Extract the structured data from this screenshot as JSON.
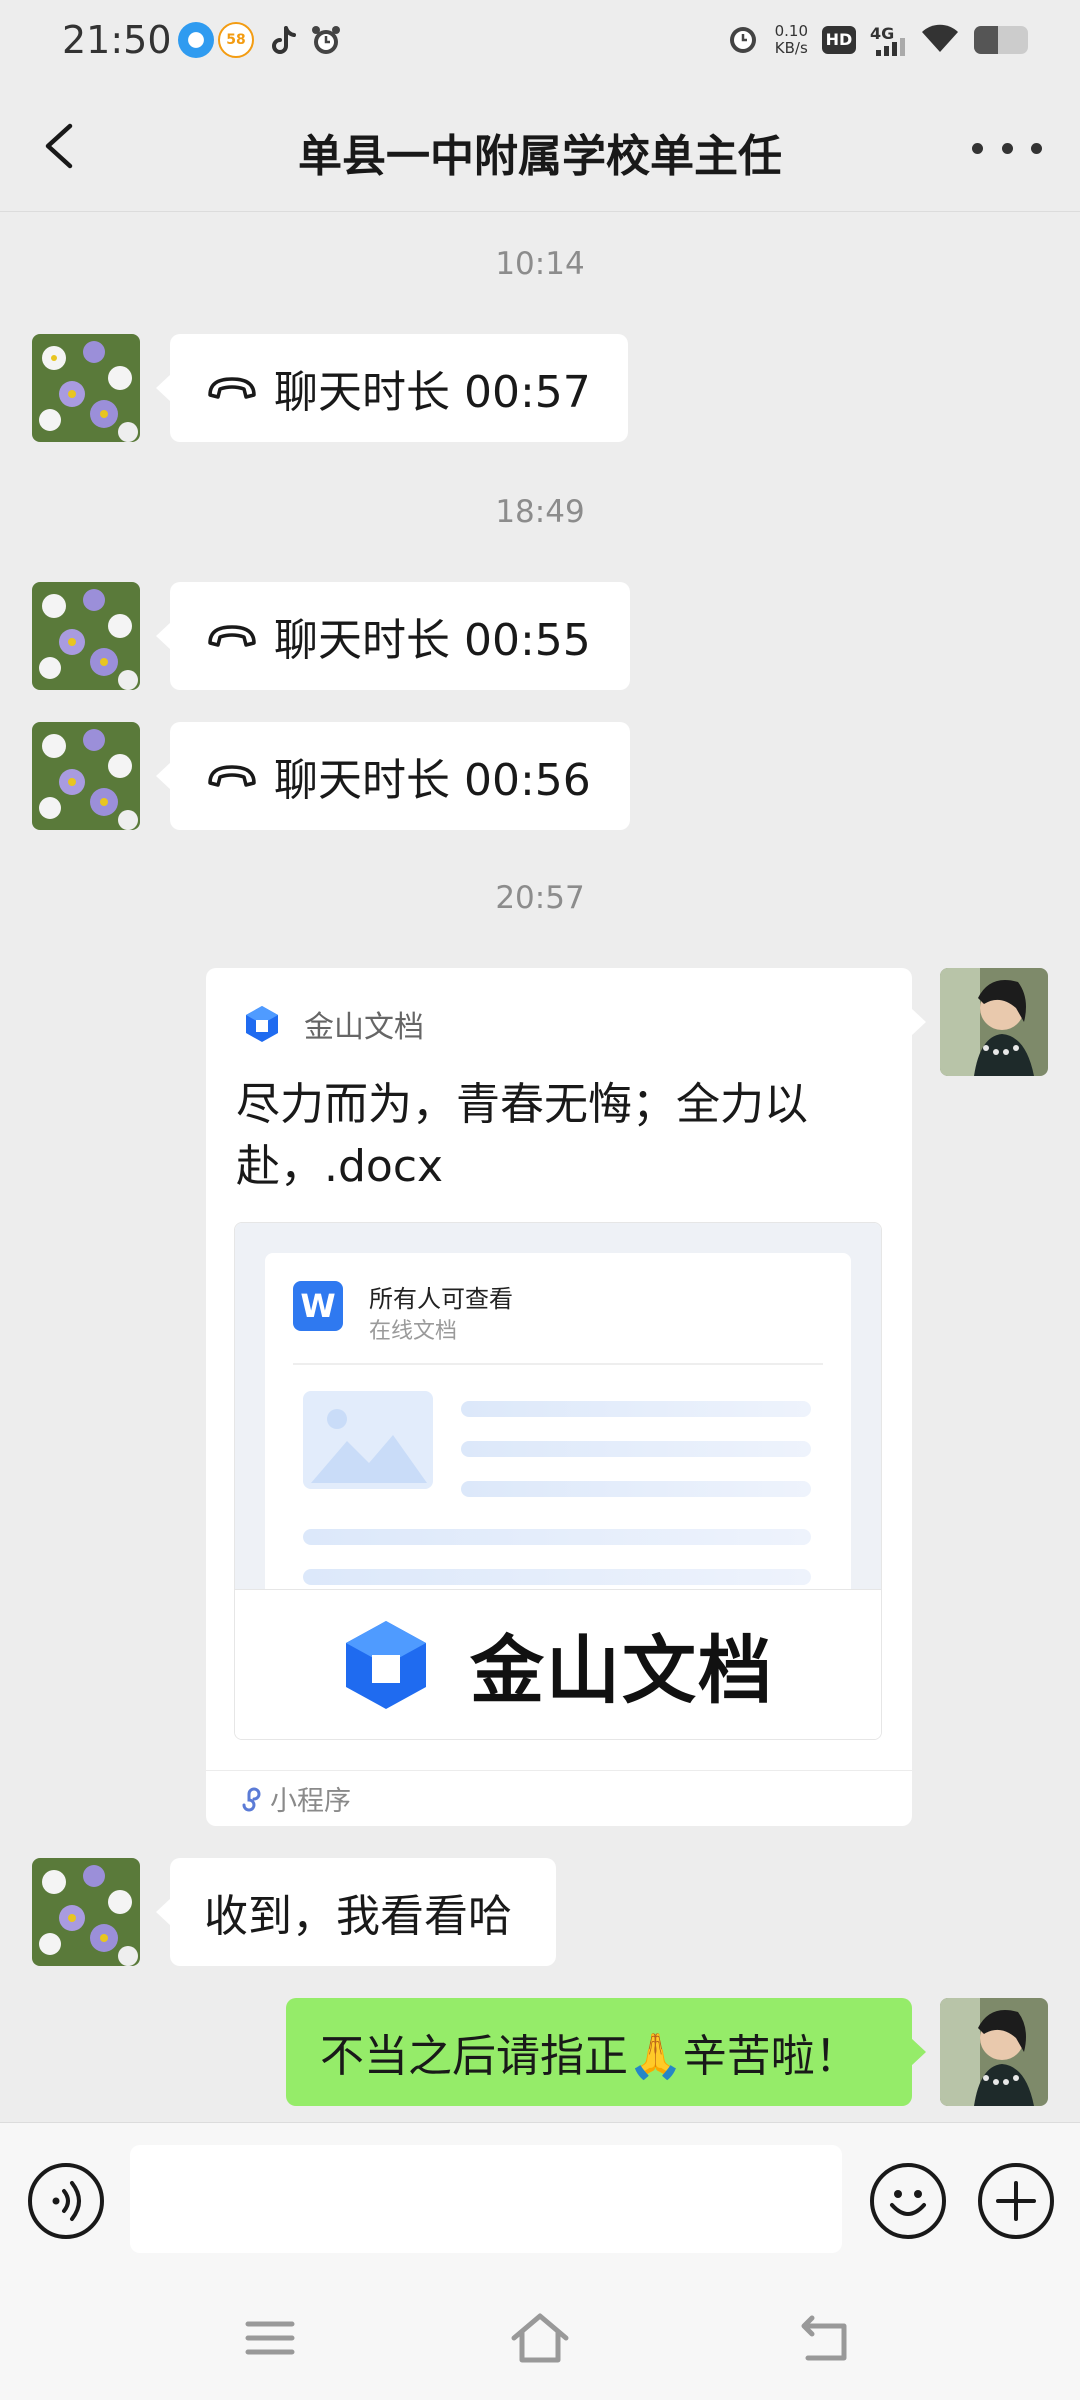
{
  "status_bar": {
    "time": "21:50",
    "app_icons": [
      "browser-icon",
      "58-icon",
      "tiktok-icon",
      "alarm-icon"
    ],
    "alarm_icon": "alarm-icon",
    "speed_value": "0.10",
    "speed_unit": "KB/s",
    "hd": "HD",
    "network": "4G",
    "wifi_icon": "wifi-icon",
    "battery_level": 0.45
  },
  "header": {
    "back_icon": "chevron-left-icon",
    "title": "单县一中附属学校单主任",
    "more_icon": "more-icon"
  },
  "messages": [
    {
      "type": "timestamp",
      "text": "10:14"
    },
    {
      "type": "call",
      "side": "left",
      "text": "聊天时长 00:57"
    },
    {
      "type": "timestamp",
      "text": "18:49"
    },
    {
      "type": "call",
      "side": "left",
      "text": "聊天时长 00:55"
    },
    {
      "type": "call",
      "side": "left",
      "text": "聊天时长 00:56"
    },
    {
      "type": "timestamp",
      "text": "20:57"
    },
    {
      "type": "card",
      "side": "right",
      "app_name": "金山文档",
      "title": "尽力而为，青春无悔；全力以赴，.docx",
      "permission": "所有人可查看",
      "doc_type": "在线文档",
      "doc_icon_letter": "W",
      "brand": "金山文档",
      "footer": "小程序"
    },
    {
      "type": "text",
      "side": "left",
      "text": "收到，我看看哈"
    },
    {
      "type": "text",
      "side": "right",
      "text": "不当之后请指正🙏辛苦啦！"
    }
  ],
  "input_bar": {
    "voice_icon": "voice-icon",
    "placeholder": "",
    "emoji_icon": "emoji-icon",
    "add_icon": "plus-icon"
  },
  "nav_bar": {
    "menu_icon": "menu-icon",
    "home_icon": "home-icon",
    "back_icon": "back-icon"
  },
  "colors": {
    "background": "#ededed",
    "sent_bubble": "#95ec69",
    "received_bubble": "#ffffff",
    "wps_blue": "#2f79f0"
  }
}
